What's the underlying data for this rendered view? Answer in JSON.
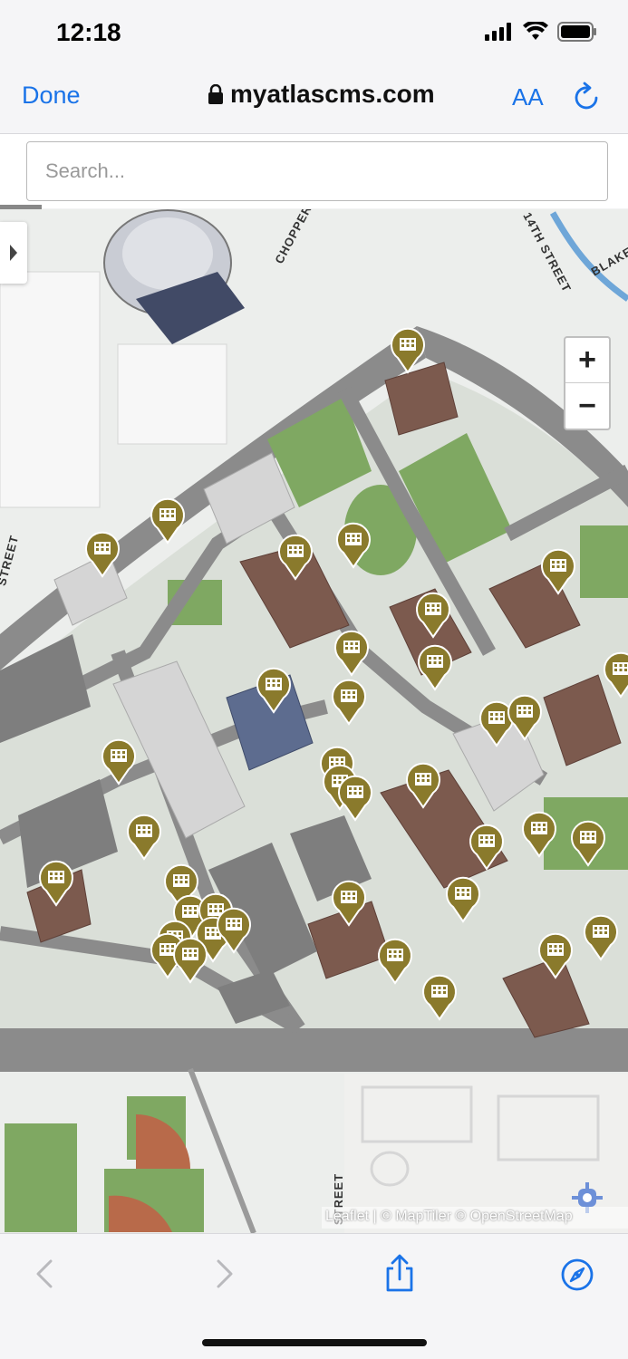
{
  "status": {
    "time": "12:18"
  },
  "nav": {
    "done": "Done",
    "url": "myatlascms.com",
    "text_size": "AA"
  },
  "search": {
    "placeholder": "Search..."
  },
  "map": {
    "zoom_in": "+",
    "zoom_out": "−",
    "attribution": "Leaflet | © MapTiler © OpenStreetMap",
    "street_labels": [
      "CHOPPER",
      "14TH STREET",
      "BLAKE",
      "STREET",
      "STREET"
    ],
    "marker_icon": "building-marker-icon",
    "marker_color": "#8a7a2c"
  },
  "toolbar": {
    "icons": [
      "back-icon",
      "forward-icon",
      "share-icon",
      "compass-icon"
    ]
  }
}
